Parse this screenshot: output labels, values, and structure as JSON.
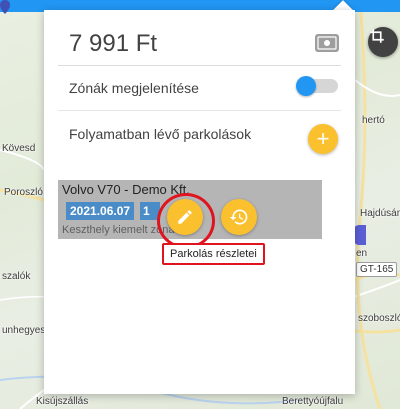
{
  "balance": "7 991 Ft",
  "zones_label": "Zónák megjelenítése",
  "zones_enabled": true,
  "parking_title": "Folyamatban lévő parkolások",
  "add_button_label": "+",
  "session": {
    "vehicle": "Volvo V70 - Demo Kft.",
    "date": "2021.06.07",
    "time": "1",
    "zone": "Keszthely kiemelt zóna"
  },
  "tooltip": "Parkolás részletei",
  "map": {
    "labels": [
      "Kövesd",
      "Poroszló",
      "szalók",
      "unhegyes",
      "Kisújszállás",
      "Berettyóújfalu",
      "hertó",
      "Hajdúsám",
      "en",
      "szoboszló",
      "Szoboszló",
      "Berettyóújfalu"
    ],
    "road_shield": "GT-165"
  },
  "icons": {
    "crop": "crop-icon",
    "money": "money-icon",
    "add": "plus-icon",
    "edit": "pencil-icon",
    "history": "history-icon",
    "pin": "map-pin-icon"
  },
  "colors": {
    "accent": "#2196f3",
    "fab": "#fbc02d",
    "highlight": "#e0141e"
  }
}
